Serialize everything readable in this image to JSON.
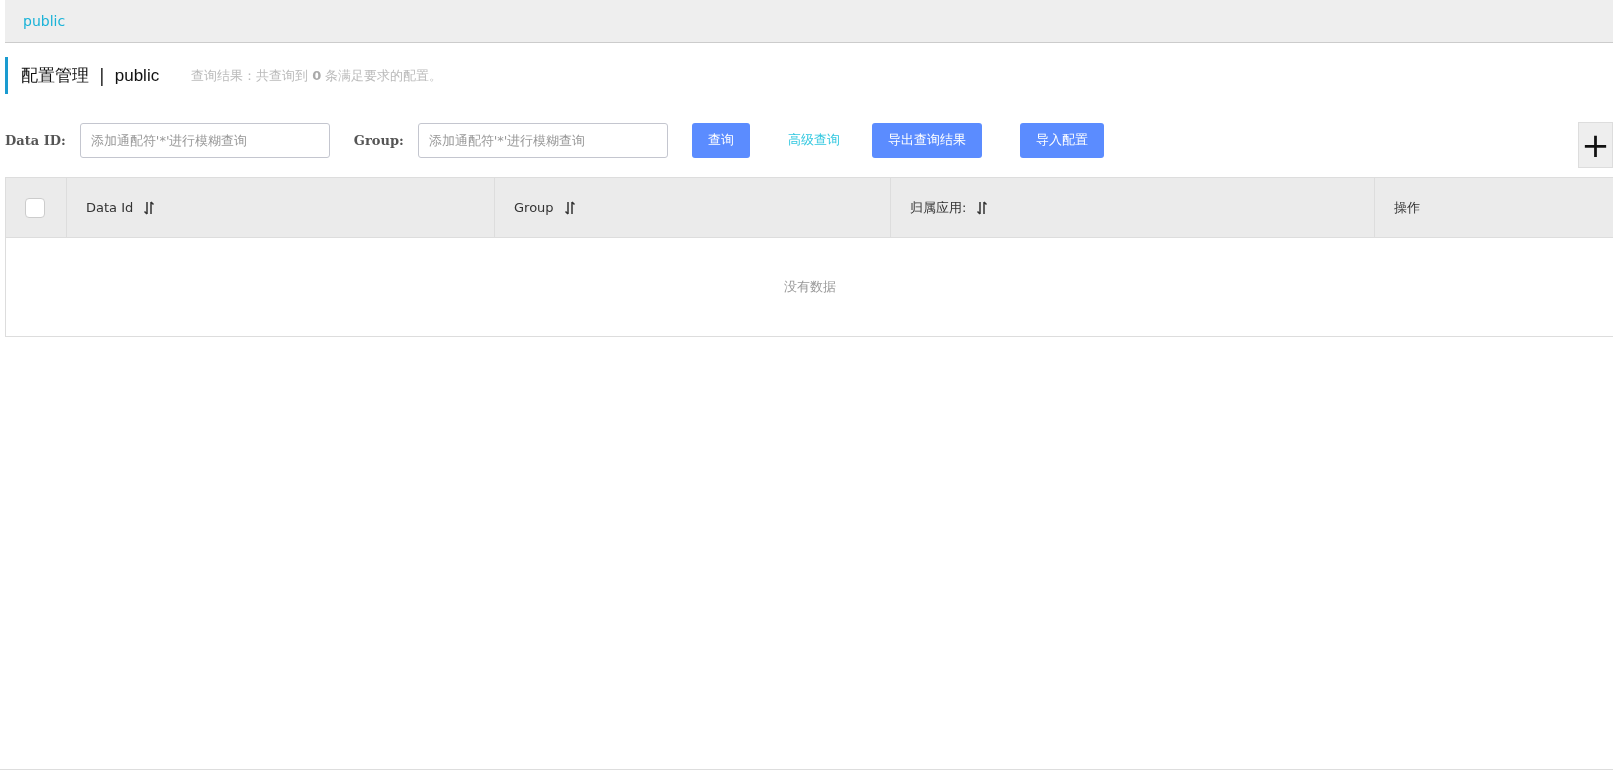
{
  "breadcrumb": {
    "label": "public"
  },
  "header": {
    "title": "配置管理",
    "separator": "|",
    "namespace": "public",
    "summary": "查询结果：共查询到 **0** 条满足要求的配置。"
  },
  "filters": [
    {
      "label": "Data ID:",
      "placeholder": "添加通配符'*'进行模糊查询"
    },
    {
      "label": "Group:",
      "placeholder": "添加通配符'*'进行模糊查询"
    }
  ],
  "actions": [
    {
      "kind": "button",
      "label": "查询"
    },
    {
      "kind": "link",
      "label": "高级查询"
    },
    {
      "kind": "button",
      "label": "导出查询结果"
    },
    {
      "kind": "button",
      "label": "导入配置"
    }
  ],
  "add_button": {
    "label": "+"
  },
  "table": {
    "select_all": {
      "checked": false
    },
    "columns": [
      {
        "label": "Data Id",
        "sortable": true
      },
      {
        "label": "Group",
        "sortable": true
      },
      {
        "label": "归属应用:",
        "sortable": true
      },
      {
        "label": "操作",
        "sortable": false
      }
    ],
    "empty_text": "没有数据"
  }
}
